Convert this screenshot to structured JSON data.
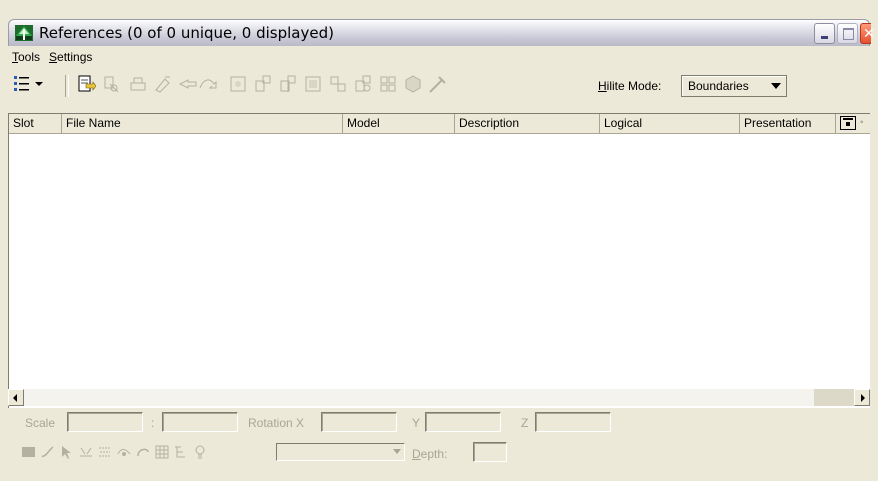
{
  "window": {
    "title": "References (0 of 0 unique, 0 displayed)"
  },
  "menu": {
    "items": [
      {
        "label_ul": "T",
        "label_rest": "ools"
      },
      {
        "label_ul": "S",
        "label_rest": "ettings"
      }
    ]
  },
  "toolbar": {
    "hilite_ul": "H",
    "hilite_rest": "ilite Mode:",
    "hilite_value": "Boundaries"
  },
  "list": {
    "columns": [
      "Slot",
      "File Name",
      "Model",
      "Description",
      "Logical",
      "Presentation"
    ]
  },
  "bottom": {
    "scale_label": "Scale",
    "scale_separator": ":",
    "rotation_x_label": "Rotation X",
    "y_label": "Y",
    "z_label": "Z",
    "depth_ul": "D",
    "depth_rest": "epth:"
  },
  "colors": {
    "window_bg": "#ece9d8",
    "disabled_text": "#a7a696",
    "list_bg": "#ffffff"
  }
}
